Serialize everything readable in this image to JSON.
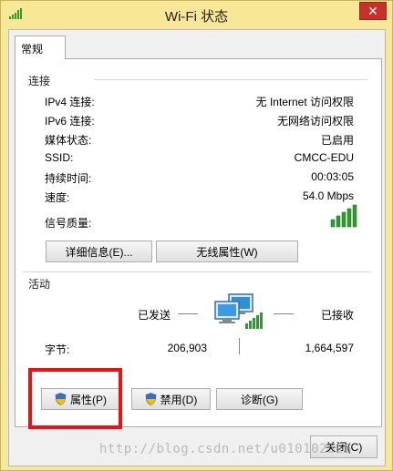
{
  "window": {
    "title": "Wi-Fi 状态",
    "close_symbol": "✕"
  },
  "tabs": [
    {
      "label": "常规",
      "active": true
    }
  ],
  "connection": {
    "section_label": "连接",
    "rows": [
      {
        "label": "IPv4 连接:",
        "value": "无 Internet 访问权限"
      },
      {
        "label": "IPv6 连接:",
        "value": "无网络访问权限"
      },
      {
        "label": "媒体状态:",
        "value": "已启用"
      },
      {
        "label": "SSID:",
        "value": "CMCC-EDU"
      },
      {
        "label": "持续时间:",
        "value": "00:03:05"
      },
      {
        "label": "速度:",
        "value": "54.0 Mbps"
      }
    ],
    "signal_label": "信号质量:",
    "signal_icon": "signal-bars-icon",
    "buttons": {
      "details": "详细信息(E)...",
      "wireless_properties": "无线属性(W)"
    }
  },
  "activity": {
    "section_label": "活动",
    "sent_label": "已发送",
    "received_label": "已接收",
    "bytes_label": "字节:",
    "bytes_sent": "206,903",
    "bytes_received": "1,664,597",
    "network_icon": "network-computers-icon"
  },
  "actions": {
    "properties": "属性(P)",
    "disable": "禁用(D)",
    "diagnose": "诊断(G)"
  },
  "footer": {
    "close": "关闭(C)"
  },
  "watermark": "http://blog.csdn.net/u010102526",
  "colors": {
    "title_bar": "#f8e796",
    "close_button": "#c9302c",
    "highlight_box": "#ee1111",
    "signal_green": "#2e9b2e"
  }
}
